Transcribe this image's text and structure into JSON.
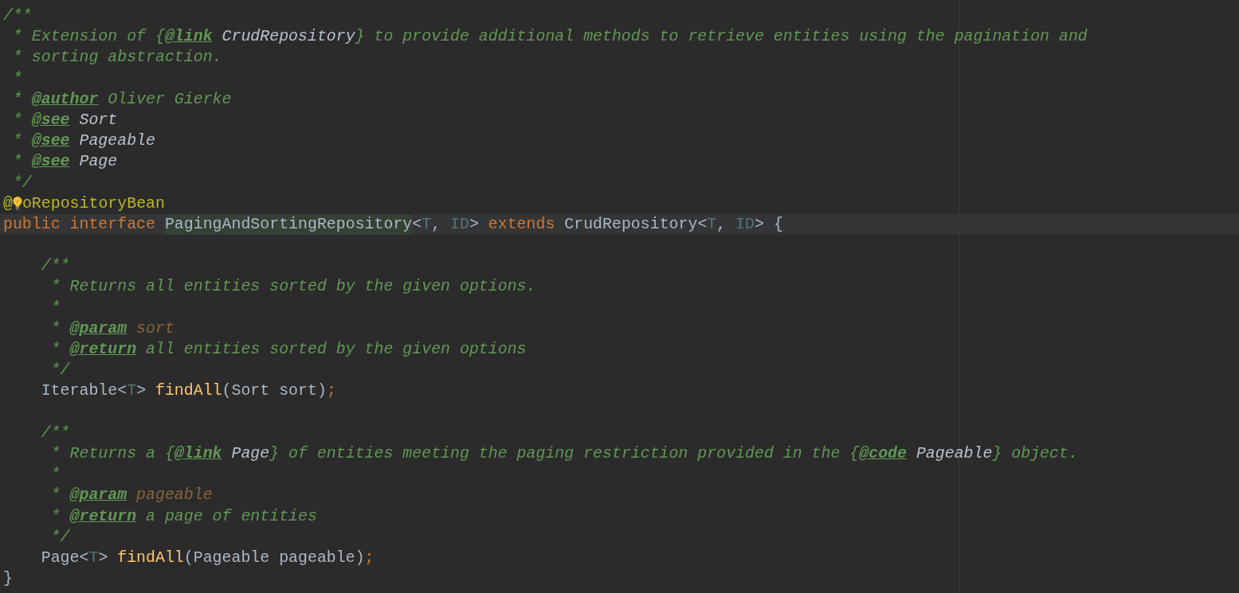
{
  "editor": {
    "lines": [
      {
        "current": false,
        "tokens": [
          {
            "kind": "comment",
            "text": "/**"
          }
        ]
      },
      {
        "current": false,
        "tokens": [
          {
            "kind": "comment",
            "text": " * Extension of {"
          },
          {
            "kind": "tag",
            "text": "@link"
          },
          {
            "kind": "ref",
            "text": " CrudRepository"
          },
          {
            "kind": "comment",
            "text": "} to provide additional methods to retrieve entities using the pagination and"
          }
        ]
      },
      {
        "current": false,
        "tokens": [
          {
            "kind": "comment",
            "text": " * sorting abstraction."
          }
        ]
      },
      {
        "current": false,
        "tokens": [
          {
            "kind": "comment",
            "text": " *"
          }
        ]
      },
      {
        "current": false,
        "tokens": [
          {
            "kind": "comment",
            "text": " * "
          },
          {
            "kind": "tag",
            "text": "@author"
          },
          {
            "kind": "comment",
            "text": " Oliver Gierke"
          }
        ]
      },
      {
        "current": false,
        "tokens": [
          {
            "kind": "comment",
            "text": " * "
          },
          {
            "kind": "tag",
            "text": "@see"
          },
          {
            "kind": "ref",
            "text": " Sort"
          }
        ]
      },
      {
        "current": false,
        "tokens": [
          {
            "kind": "comment",
            "text": " * "
          },
          {
            "kind": "tag",
            "text": "@see"
          },
          {
            "kind": "ref",
            "text": " Pageable"
          }
        ]
      },
      {
        "current": false,
        "tokens": [
          {
            "kind": "comment",
            "text": " * "
          },
          {
            "kind": "tag",
            "text": "@see"
          },
          {
            "kind": "ref",
            "text": " Page"
          }
        ]
      },
      {
        "current": false,
        "tokens": [
          {
            "kind": "comment",
            "text": " */"
          }
        ]
      },
      {
        "current": false,
        "tokens": [
          {
            "kind": "annotation",
            "text": "@"
          },
          {
            "kind": "bulb"
          },
          {
            "kind": "annotation",
            "text": "oRepositoryBean"
          }
        ]
      },
      {
        "current": true,
        "tokens": [
          {
            "kind": "keyword",
            "text": "public interface "
          },
          {
            "kind": "declared-class",
            "text": "PagingAndSortingRepository"
          },
          {
            "kind": "plain",
            "text": "<"
          },
          {
            "kind": "typeparam",
            "text": "T"
          },
          {
            "kind": "plain",
            "text": ", "
          },
          {
            "kind": "typeparam",
            "text": "ID"
          },
          {
            "kind": "plain",
            "text": "> "
          },
          {
            "kind": "keyword",
            "text": "extends "
          },
          {
            "kind": "plain",
            "text": "CrudRepository<"
          },
          {
            "kind": "typeparam",
            "text": "T"
          },
          {
            "kind": "plain",
            "text": ", "
          },
          {
            "kind": "typeparam",
            "text": "ID"
          },
          {
            "kind": "plain",
            "text": "> {"
          }
        ]
      },
      {
        "current": false
      },
      {
        "current": false,
        "tokens": [
          {
            "kind": "comment",
            "text": "    /**"
          }
        ]
      },
      {
        "current": false,
        "tokens": [
          {
            "kind": "comment",
            "text": "     * Returns all entities sorted by the given options."
          }
        ]
      },
      {
        "current": false,
        "tokens": [
          {
            "kind": "comment",
            "text": "     *"
          }
        ]
      },
      {
        "current": false,
        "tokens": [
          {
            "kind": "comment",
            "text": "     * "
          },
          {
            "kind": "tag",
            "text": "@param"
          },
          {
            "kind": "param-ref",
            "text": " sort"
          }
        ]
      },
      {
        "current": false,
        "tokens": [
          {
            "kind": "comment",
            "text": "     * "
          },
          {
            "kind": "tag",
            "text": "@return"
          },
          {
            "kind": "comment",
            "text": " all entities sorted by the given options"
          }
        ]
      },
      {
        "current": false,
        "tokens": [
          {
            "kind": "comment",
            "text": "     */"
          }
        ]
      },
      {
        "current": false,
        "tokens": [
          {
            "kind": "plain",
            "text": "    Iterable<"
          },
          {
            "kind": "typeparam",
            "text": "T"
          },
          {
            "kind": "plain",
            "text": "> "
          },
          {
            "kind": "method",
            "text": "findAll"
          },
          {
            "kind": "plain",
            "text": "(Sort sort)"
          },
          {
            "kind": "punct",
            "text": ";"
          }
        ]
      },
      {
        "current": false
      },
      {
        "current": false,
        "tokens": [
          {
            "kind": "comment",
            "text": "    /**"
          }
        ]
      },
      {
        "current": false,
        "tokens": [
          {
            "kind": "comment",
            "text": "     * Returns a {"
          },
          {
            "kind": "tag",
            "text": "@link"
          },
          {
            "kind": "ref",
            "text": " Page"
          },
          {
            "kind": "comment",
            "text": "} of entities meeting the paging restriction provided in the {"
          },
          {
            "kind": "tag",
            "text": "@code"
          },
          {
            "kind": "ref",
            "text": " Pageable"
          },
          {
            "kind": "comment",
            "text": "} object."
          }
        ]
      },
      {
        "current": false,
        "tokens": [
          {
            "kind": "comment",
            "text": "     *"
          }
        ]
      },
      {
        "current": false,
        "tokens": [
          {
            "kind": "comment",
            "text": "     * "
          },
          {
            "kind": "tag",
            "text": "@param"
          },
          {
            "kind": "param-ref",
            "text": " pageable"
          }
        ]
      },
      {
        "current": false,
        "tokens": [
          {
            "kind": "comment",
            "text": "     * "
          },
          {
            "kind": "tag",
            "text": "@return"
          },
          {
            "kind": "comment",
            "text": " a page of entities"
          }
        ]
      },
      {
        "current": false,
        "tokens": [
          {
            "kind": "comment",
            "text": "     */"
          }
        ]
      },
      {
        "current": false,
        "tokens": [
          {
            "kind": "plain",
            "text": "    Page<"
          },
          {
            "kind": "typeparam",
            "text": "T"
          },
          {
            "kind": "plain",
            "text": "> "
          },
          {
            "kind": "method",
            "text": "findAll"
          },
          {
            "kind": "plain",
            "text": "(Pageable pageable)"
          },
          {
            "kind": "punct",
            "text": ";"
          }
        ]
      },
      {
        "current": false,
        "tokens": [
          {
            "kind": "plain",
            "text": "}"
          }
        ]
      }
    ]
  }
}
